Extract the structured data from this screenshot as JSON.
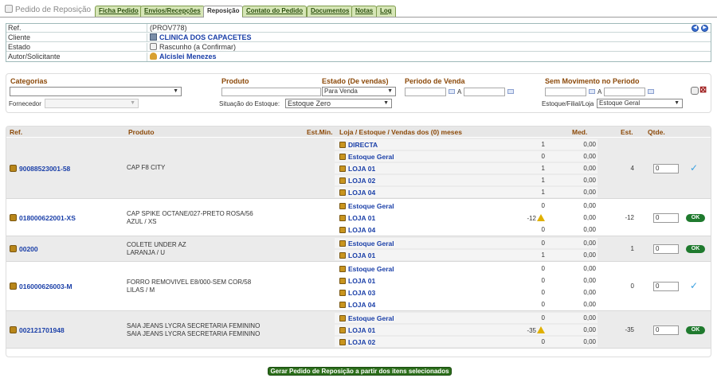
{
  "app": {
    "title": "Pedido de Reposição"
  },
  "tabs": [
    {
      "label": "Ficha Pedido"
    },
    {
      "label": "Envios/Recepções"
    },
    {
      "label": "Reposição"
    },
    {
      "label": "Contato do Pedido"
    },
    {
      "label": "Documentos"
    },
    {
      "label": "Notas"
    },
    {
      "label": "Log"
    }
  ],
  "header": {
    "ref_label": "Ref.",
    "ref_value": "(PROV778)",
    "cliente_label": "Cliente",
    "cliente_value": "CLINICA DOS CAPACETES",
    "estado_label": "Estado",
    "estado_value": "Rascunho (a Confirmar)",
    "autor_label": "Autor/Solicitante",
    "autor_value": "Alcislei Menezes"
  },
  "filters": {
    "categorias_label": "Categorias",
    "produto_label": "Produto",
    "estado_vendas_label": "Estado (De vendas)",
    "estado_vendas_value": "Para Venda",
    "periodo_label": "Periodo de Venda",
    "periodo_a": "A",
    "sem_mov_label": "Sem Movimento no Periodo",
    "sem_mov_a": "A",
    "fornecedor_label": "Fornecedor",
    "situacao_label": "Situação do Estoque:",
    "situacao_value": "Estoque Zero",
    "estoque_filial_label": "Estoque/Filial/Loja",
    "estoque_filial_value": "Estoque Geral"
  },
  "table": {
    "headers": {
      "ref": "Ref.",
      "produto": "Produto",
      "estmin": "Est.Min.",
      "loja": "Loja / Estoque / Vendas dos (0) meses",
      "med": "Med.",
      "est": "Est.",
      "qtde": "Qtde."
    },
    "rows": [
      {
        "ref": "90088523001-58",
        "produto_l1": "CAP F8 CITY",
        "produto_l2": "",
        "est": "4",
        "qtde": "0",
        "action": "check",
        "stores": [
          {
            "name": "DIRECTA",
            "qty": "1",
            "med": "0,00",
            "warn": false
          },
          {
            "name": "Estoque Geral",
            "qty": "0",
            "med": "0,00",
            "warn": false
          },
          {
            "name": "LOJA 01",
            "qty": "1",
            "med": "0,00",
            "warn": false
          },
          {
            "name": "LOJA 02",
            "qty": "1",
            "med": "0,00",
            "warn": false
          },
          {
            "name": "LOJA 04",
            "qty": "1",
            "med": "0,00",
            "warn": false
          }
        ]
      },
      {
        "ref": "018000622001-XS",
        "produto_l1": "CAP SPIKE OCTANE/027-PRETO ROSA/56",
        "produto_l2": "AZUL / XS",
        "est": "-12",
        "qtde": "0",
        "action": "ok",
        "stores": [
          {
            "name": "Estoque Geral",
            "qty": "0",
            "med": "0,00",
            "warn": false
          },
          {
            "name": "LOJA 01",
            "qty": "-12",
            "med": "0,00",
            "warn": true
          },
          {
            "name": "LOJA 04",
            "qty": "0",
            "med": "0,00",
            "warn": false
          }
        ]
      },
      {
        "ref": "00200",
        "produto_l1": "COLETE UNDER AZ",
        "produto_l2": "LARANJA / U",
        "est": "1",
        "qtde": "0",
        "action": "ok",
        "stores": [
          {
            "name": "Estoque Geral",
            "qty": "0",
            "med": "0,00",
            "warn": false
          },
          {
            "name": "LOJA 01",
            "qty": "1",
            "med": "0,00",
            "warn": false
          }
        ]
      },
      {
        "ref": "016000626003-M",
        "produto_l1": "FORRO REMOVIVEL E8/000-SEM COR/58",
        "produto_l2": "LILAS / M",
        "est": "0",
        "qtde": "0",
        "action": "check",
        "stores": [
          {
            "name": "Estoque Geral",
            "qty": "0",
            "med": "0,00",
            "warn": false
          },
          {
            "name": "LOJA 01",
            "qty": "0",
            "med": "0,00",
            "warn": false
          },
          {
            "name": "LOJA 03",
            "qty": "0",
            "med": "0,00",
            "warn": false
          },
          {
            "name": "LOJA 04",
            "qty": "0",
            "med": "0,00",
            "warn": false
          }
        ]
      },
      {
        "ref": "002121701948",
        "produto_l1": "SAIA JEANS LYCRA SECRETARIA FEMININO",
        "produto_l2": "SAIA JEANS LYCRA SECRETARIA  FEMININO",
        "est": "-35",
        "qtde": "0",
        "action": "ok",
        "stores": [
          {
            "name": "Estoque Geral",
            "qty": "0",
            "med": "0,00",
            "warn": false
          },
          {
            "name": "LOJA 01",
            "qty": "-35",
            "med": "0,00",
            "warn": true
          },
          {
            "name": "LOJA 02",
            "qty": "0",
            "med": "0,00",
            "warn": false
          }
        ]
      }
    ],
    "ok_label": "OK",
    "check_glyph": "✓"
  },
  "footer": {
    "gerar_label": "Gerar Pedido de Reposição a partir dos itens selecionados"
  },
  "colors": {
    "accent_green": "#2b6e1a",
    "link_blue": "#1a3fa8",
    "header_brown": "#8c4a0a"
  }
}
